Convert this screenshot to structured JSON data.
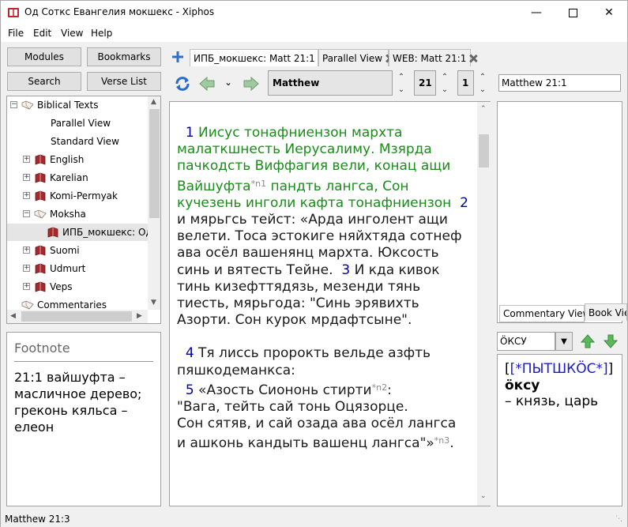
{
  "window": {
    "title": "Од Соткс Евангелия мокшекс - Xiphos"
  },
  "menu": [
    "File",
    "Edit",
    "View",
    "Help"
  ],
  "sidebar_buttons": {
    "modules": "Modules",
    "bookmarks": "Bookmarks",
    "search": "Search",
    "verse_list": "Verse List"
  },
  "tree": [
    {
      "label": "Biblical Texts",
      "exp": "−",
      "icon": "folder-open"
    },
    {
      "label": "Parallel View",
      "exp": "",
      "icon": ""
    },
    {
      "label": "Standard View",
      "exp": "",
      "icon": ""
    },
    {
      "label": "English",
      "exp": "+",
      "icon": "book"
    },
    {
      "label": "Karelian",
      "exp": "+",
      "icon": "book"
    },
    {
      "label": "Komi-Permyak",
      "exp": "+",
      "icon": "book"
    },
    {
      "label": "Moksha",
      "exp": "−",
      "icon": "folder-open"
    },
    {
      "label": "ИПБ_мокшекс: Од",
      "exp": "",
      "icon": "book"
    },
    {
      "label": "Suomi",
      "exp": "+",
      "icon": "book"
    },
    {
      "label": "Udmurt",
      "exp": "+",
      "icon": "book"
    },
    {
      "label": "Veps",
      "exp": "+",
      "icon": "book"
    },
    {
      "label": "Commentaries",
      "exp": "",
      "icon": "folder-open"
    }
  ],
  "footnote": {
    "title": "Footnote",
    "text": "21:1 вайшуфта – масличное дерево; греконь кяльса – елеон"
  },
  "tabs": [
    {
      "label": "ИПБ_мокшекс: Matt 21:1"
    },
    {
      "label": "Parallel View"
    },
    {
      "label": "WEB: Matt 21:1"
    }
  ],
  "nav": {
    "book": "Matthew",
    "chapter": "21",
    "verse": "1",
    "reference": "Matthew 21:1"
  },
  "bible": {
    "v1_num": "1",
    "v1a": "Иисус тонафниензон мархта малаткшнесть Иерусалиму. Мзярда пачкодсть Виффагия вели, конац ащи Вайшуфта",
    "n1": "*n1",
    "v1b": " пандть лангса, Сон кучезень инголи кафта тонафниензон",
    "v2_num": "2",
    "v2": "и мярьгсь тейст: «Арда инголент ащи велети. Тоса эстокиге няйхтяда сотнеф ава осёл вашенянц мархта. Юксость синь и вятесть Тейне.",
    "v3_num": "3",
    "v3": "И кда кивок тинь кизефттядязь, мезенди тянь тиесть, мярьгода: \"Синь эрявихть Азорти. Сон курок мрдафтсыне\".",
    "v4_num": "4",
    "v4": "Тя лиссь пророкть вельде азфть пяшкодеманкса:",
    "v5_num": "5",
    "v5a": "«Азость Сиононь стирти",
    "n2": "*n2",
    "v5b": ":",
    "v5c": "\"Вага, тейть сай тонь Оцязорце.",
    "v5d": "Сон сятяв, и сай озада ава осёл лангса",
    "v5e": "и ашконь кандыть вашенц лангса\"»",
    "n3": "*n3",
    "v5f": "."
  },
  "right_tabs": {
    "commentary": "Commentary View",
    "book": "Book View"
  },
  "dictionary": {
    "entry": "ÖКСУ",
    "heading": "[*ПЫТШКÖС*]",
    "word": "öксу",
    "definition": "– князь, царь"
  },
  "status": "Matthew 21:3"
}
